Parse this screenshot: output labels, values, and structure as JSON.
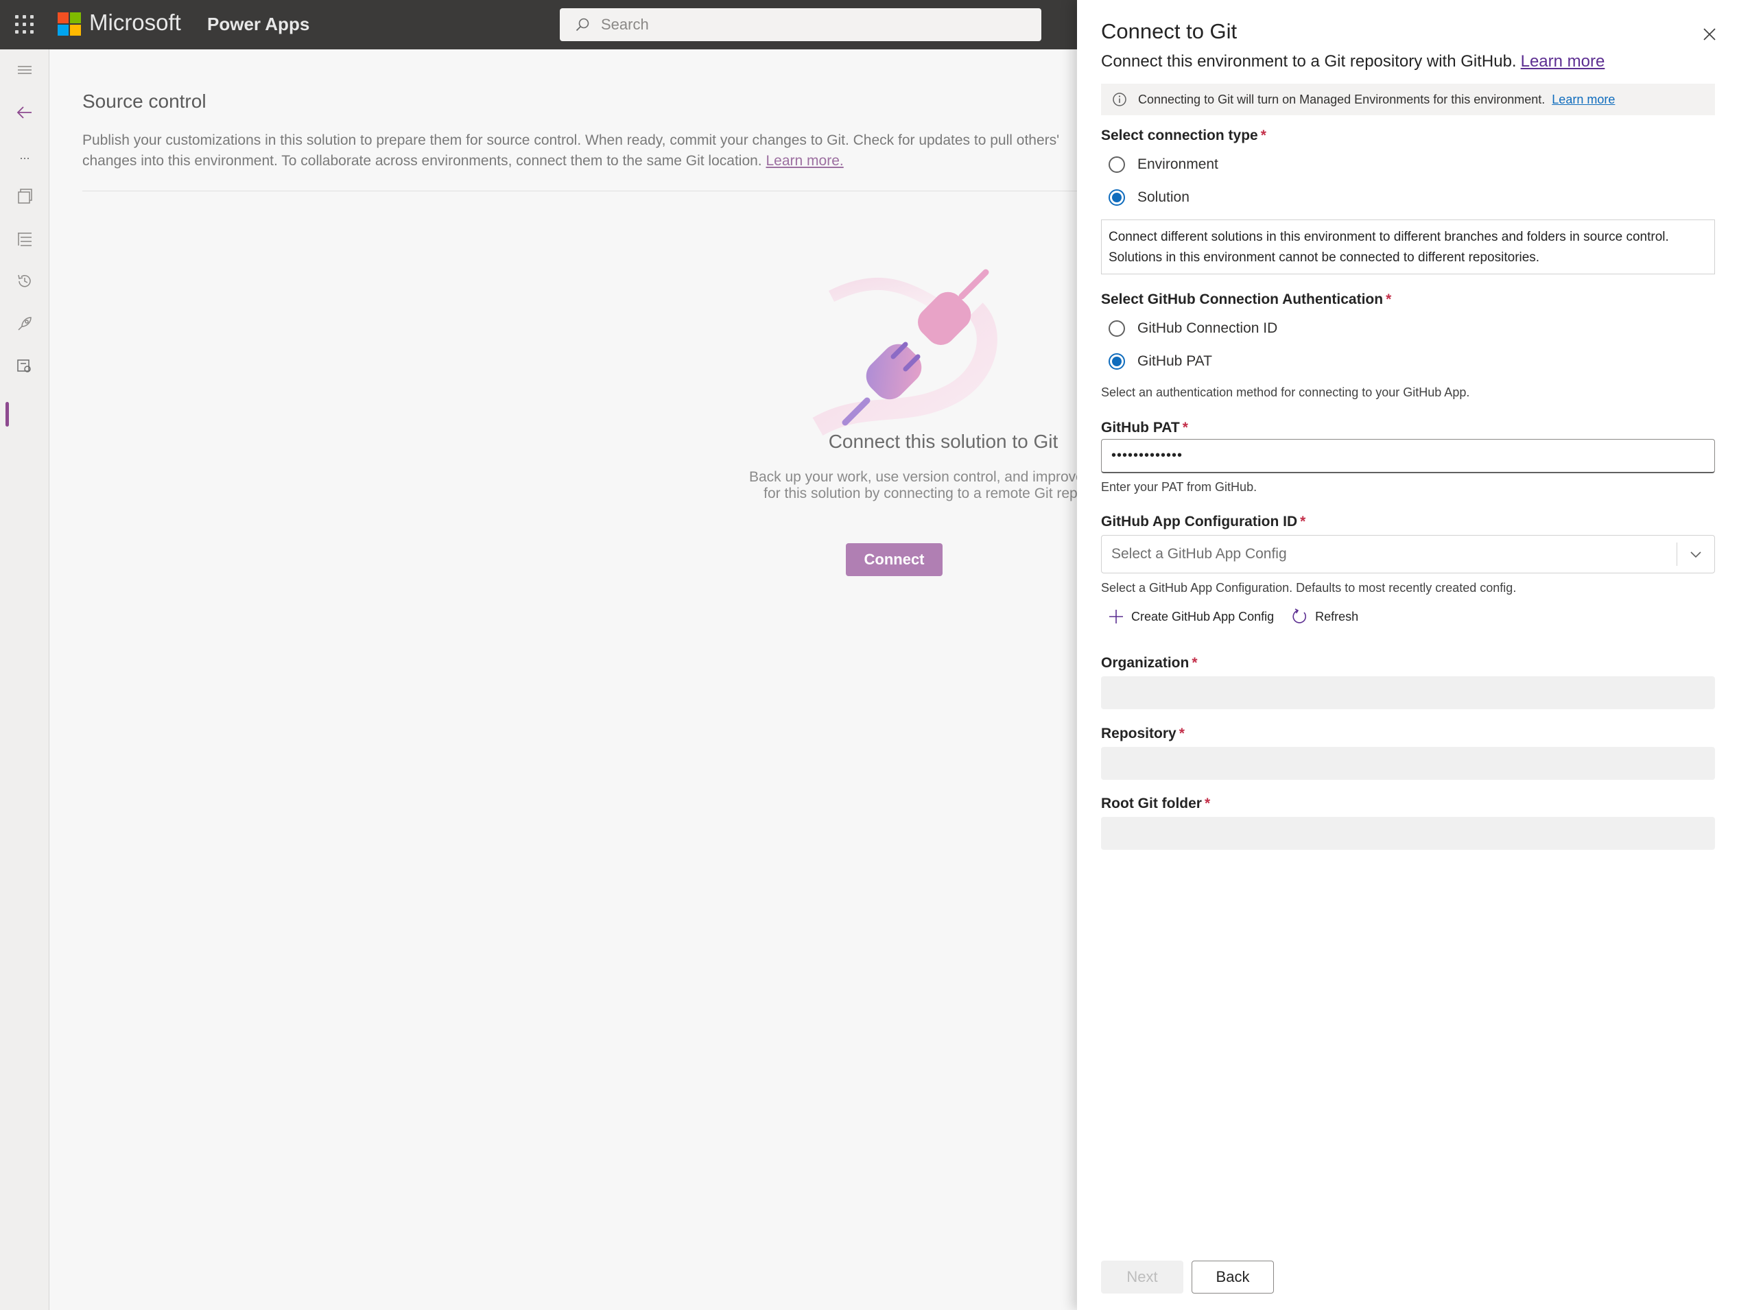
{
  "topbar": {
    "brand": "Microsoft",
    "app_name": "Power Apps",
    "search_placeholder": "Search"
  },
  "leftrail": {
    "items": [
      "menu-icon",
      "back-arrow-icon",
      "more-icon",
      "solutions-icon",
      "objects-icon",
      "history-icon",
      "rocket-icon",
      "source-control-icon"
    ],
    "more_label": "..."
  },
  "main": {
    "title": "Source control",
    "description": "Publish your customizations in this solution to prepare them for source control. When ready, commit your changes to Git. Check for updates to pull others' changes into this environment. To collaborate across environments, connect them to the same Git location.",
    "learn_more": "Learn more.",
    "empty_title": "Connect this solution to Git",
    "empty_body": "Back up your work, use version control, and improve security for this solution by connecting to a remote Git repository.",
    "connect_button": "Connect"
  },
  "panel": {
    "title": "Connect to Git",
    "subtitle": "Connect this environment to a Git repository with GitHub.",
    "subtitle_link": "Learn more",
    "info_text": "Connecting to Git will turn on Managed Environments for this environment.",
    "info_link": "Learn more",
    "connection_type_label": "Select connection type",
    "connection_types": [
      {
        "label": "Environment",
        "selected": false
      },
      {
        "label": "Solution",
        "selected": true
      }
    ],
    "connection_type_description": "Connect different solutions in this environment to different branches and folders in source control. Solutions in this environment cannot be connected to different repositories.",
    "auth_label": "Select GitHub Connection Authentication",
    "auth_options": [
      {
        "label": "GitHub Connection ID",
        "selected": false
      },
      {
        "label": "GitHub PAT",
        "selected": true
      }
    ],
    "auth_help": "Select an authentication method for connecting to your GitHub App.",
    "pat_label": "GitHub PAT",
    "pat_value": "•••••••••••••",
    "pat_help": "Enter your PAT from GitHub.",
    "app_config_label": "GitHub App Configuration ID",
    "app_config_placeholder": "Select a GitHub App Config",
    "app_config_help": "Select a GitHub App Configuration. Defaults to most recently created config.",
    "create_config": "Create GitHub App Config",
    "refresh": "Refresh",
    "organization_label": "Organization",
    "repository_label": "Repository",
    "root_folder_label": "Root Git folder",
    "required_mark": "*",
    "next_button": "Next",
    "back_button": "Back"
  },
  "colors": {
    "topbar": "#3b3a39",
    "accent": "#0f6cbd",
    "connect_button": "#b07fb3",
    "required": "#c4314b"
  }
}
